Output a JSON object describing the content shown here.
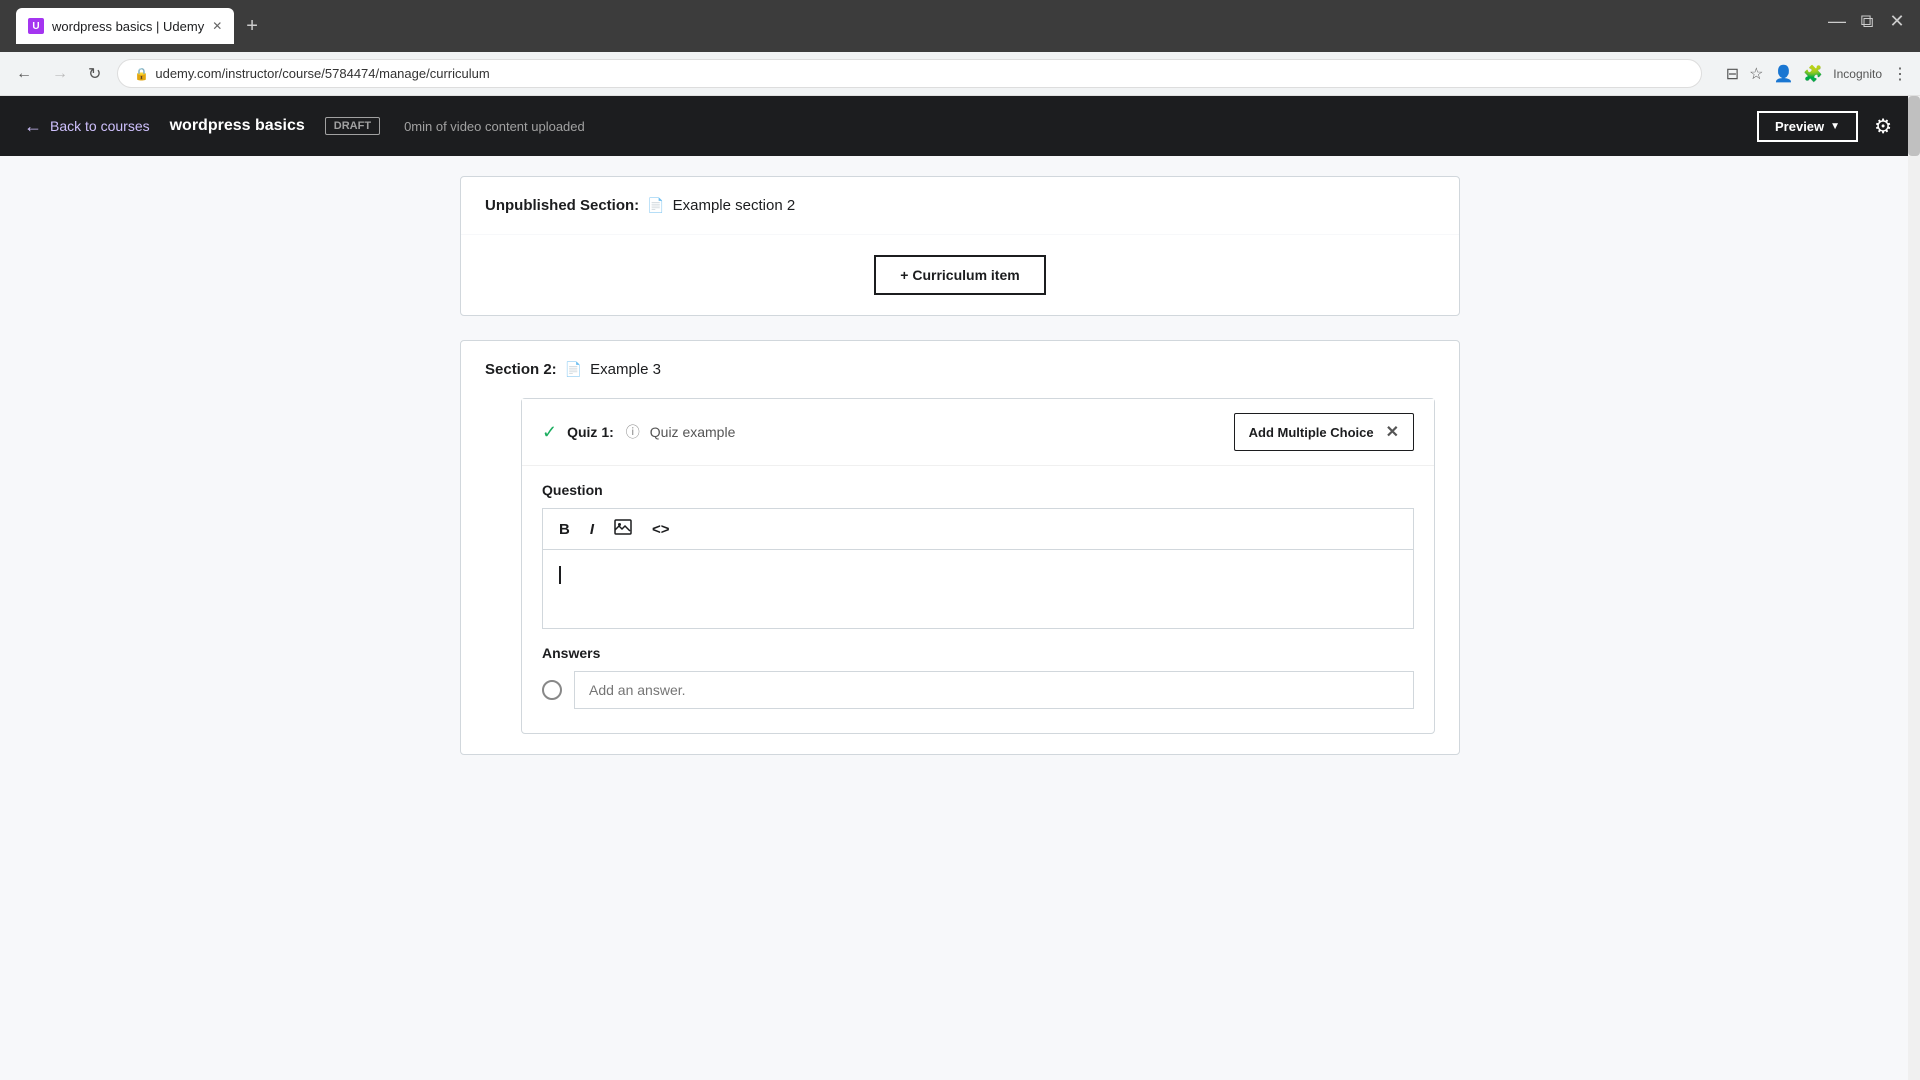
{
  "browser": {
    "tab_title": "wordpress basics | Udemy",
    "new_tab_label": "+",
    "url": "udemy.com/instructor/course/5784474/manage/curriculum",
    "incognito_label": "Incognito",
    "win_minimize": "—",
    "win_restore": "⧉",
    "win_close": "✕"
  },
  "header": {
    "back_label": "Back to courses",
    "course_title": "wordpress basics",
    "badge_label": "DRAFT",
    "video_info": "0min of video content uploaded",
    "preview_btn": "Preview",
    "settings_icon": "⚙"
  },
  "unpublished_section": {
    "label": "Unpublished Section:",
    "name": "Example section 2",
    "curriculum_btn": "+ Curriculum item"
  },
  "section2": {
    "label": "Section 2:",
    "name": "Example 3"
  },
  "quiz": {
    "title": "Quiz 1:",
    "example": "Quiz example",
    "add_btn": "Add Multiple Choice",
    "close_icon": "✕"
  },
  "question": {
    "label": "Question",
    "toolbar_bold": "B",
    "toolbar_italic": "I",
    "toolbar_image": "🖼",
    "toolbar_code": "<>"
  },
  "answers": {
    "label": "Answers",
    "placeholder": "Add an answer."
  }
}
